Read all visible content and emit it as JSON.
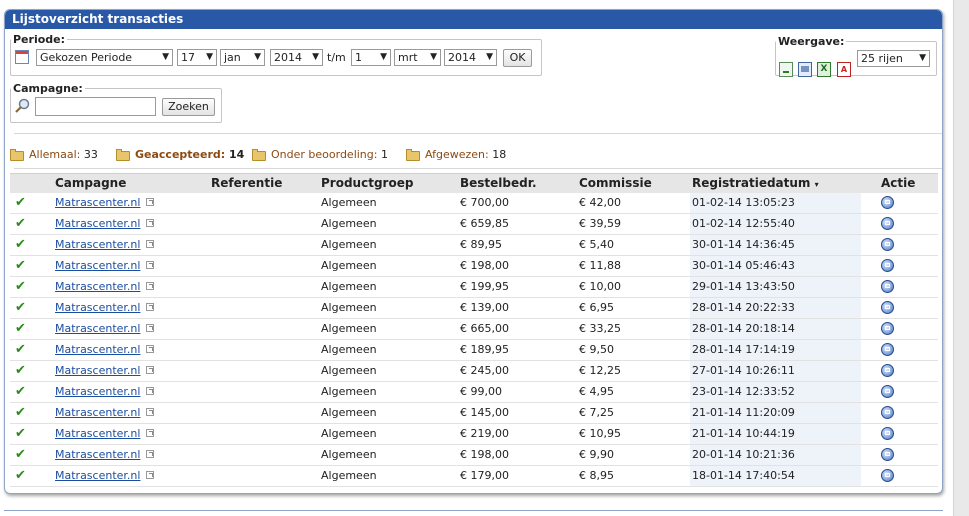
{
  "panel": {
    "title": "Lijstoverzicht transacties"
  },
  "periode": {
    "legend": "Periode:",
    "type": "Gekozen Periode",
    "from_day": "17",
    "from_month": "jan",
    "from_year": "2014",
    "tm": "t/m",
    "to_day": "1",
    "to_month": "mrt",
    "to_year": "2014",
    "ok": "OK"
  },
  "campagne": {
    "legend": "Campagne:",
    "input_value": "",
    "search": "Zoeken"
  },
  "weergave": {
    "legend": "Weergave:",
    "rows": "25 rijen",
    "icons": [
      "export-icon",
      "print-icon",
      "excel-icon",
      "pdf-icon"
    ]
  },
  "summary": [
    {
      "label": "Allemaal:",
      "count": "33",
      "bold": false
    },
    {
      "label": "Geaccepteerd:",
      "count": "14",
      "bold": true
    },
    {
      "label": "Onder beoordeling:",
      "count": "1",
      "bold": false
    },
    {
      "label": "Afgewezen:",
      "count": "18",
      "bold": false
    }
  ],
  "columns": [
    "Campagne",
    "Referentie",
    "Productgroep",
    "Bestelbedr.",
    "Commissie",
    "Registratiedatum",
    "Actie"
  ],
  "sort_indicator": "▾",
  "rows": [
    {
      "campagne": "Matrascenter.nl",
      "referentie": "",
      "productgroep": "Algemeen",
      "bestelbedr": "€ 700,00",
      "commissie": "€ 42,00",
      "datum": "01-02-14 13:05:23"
    },
    {
      "campagne": "Matrascenter.nl",
      "referentie": "",
      "productgroep": "Algemeen",
      "bestelbedr": "€ 659,85",
      "commissie": "€ 39,59",
      "datum": "01-02-14 12:55:40"
    },
    {
      "campagne": "Matrascenter.nl",
      "referentie": "",
      "productgroep": "Algemeen",
      "bestelbedr": "€ 89,95",
      "commissie": "€ 5,40",
      "datum": "30-01-14 14:36:45"
    },
    {
      "campagne": "Matrascenter.nl",
      "referentie": "",
      "productgroep": "Algemeen",
      "bestelbedr": "€ 198,00",
      "commissie": "€ 11,88",
      "datum": "30-01-14 05:46:43"
    },
    {
      "campagne": "Matrascenter.nl",
      "referentie": "",
      "productgroep": "Algemeen",
      "bestelbedr": "€ 199,95",
      "commissie": "€ 10,00",
      "datum": "29-01-14 13:43:50"
    },
    {
      "campagne": "Matrascenter.nl",
      "referentie": "",
      "productgroep": "Algemeen",
      "bestelbedr": "€ 139,00",
      "commissie": "€ 6,95",
      "datum": "28-01-14 20:22:33"
    },
    {
      "campagne": "Matrascenter.nl",
      "referentie": "",
      "productgroep": "Algemeen",
      "bestelbedr": "€ 665,00",
      "commissie": "€ 33,25",
      "datum": "28-01-14 20:18:14"
    },
    {
      "campagne": "Matrascenter.nl",
      "referentie": "",
      "productgroep": "Algemeen",
      "bestelbedr": "€ 189,95",
      "commissie": "€ 9,50",
      "datum": "28-01-14 17:14:19"
    },
    {
      "campagne": "Matrascenter.nl",
      "referentie": "",
      "productgroep": "Algemeen",
      "bestelbedr": "€ 245,00",
      "commissie": "€ 12,25",
      "datum": "27-01-14 10:26:11"
    },
    {
      "campagne": "Matrascenter.nl",
      "referentie": "",
      "productgroep": "Algemeen",
      "bestelbedr": "€ 99,00",
      "commissie": "€ 4,95",
      "datum": "23-01-14 12:33:52"
    },
    {
      "campagne": "Matrascenter.nl",
      "referentie": "",
      "productgroep": "Algemeen",
      "bestelbedr": "€ 145,00",
      "commissie": "€ 7,25",
      "datum": "21-01-14 11:20:09"
    },
    {
      "campagne": "Matrascenter.nl",
      "referentie": "",
      "productgroep": "Algemeen",
      "bestelbedr": "€ 219,00",
      "commissie": "€ 10,95",
      "datum": "21-01-14 10:44:19"
    },
    {
      "campagne": "Matrascenter.nl",
      "referentie": "",
      "productgroep": "Algemeen",
      "bestelbedr": "€ 198,00",
      "commissie": "€ 9,90",
      "datum": "20-01-14 10:21:36"
    },
    {
      "campagne": "Matrascenter.nl",
      "referentie": "",
      "productgroep": "Algemeen",
      "bestelbedr": "€ 179,00",
      "commissie": "€ 8,95",
      "datum": "18-01-14 17:40:54"
    }
  ],
  "colors": {
    "header": "#2858a6",
    "link": "#1c4ea0",
    "check": "#2a8a1a"
  }
}
